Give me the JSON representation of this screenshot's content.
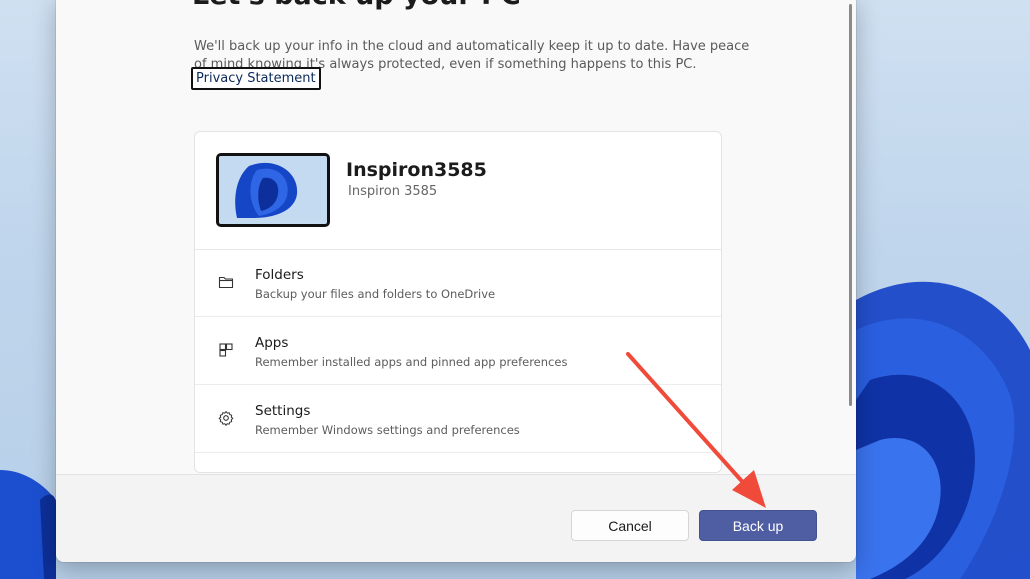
{
  "dialog": {
    "title": "Let's back up your PC",
    "intro": "We'll back up your info in the cloud and automatically keep it up to date. Have peace of mind knowing it's always protected, even if something happens to this PC.",
    "privacy_link": "Privacy Statement"
  },
  "device": {
    "name": "Inspiron3585",
    "model": "Inspiron 3585"
  },
  "options": [
    {
      "icon": "folder-icon",
      "title": "Folders",
      "subtitle": "Backup your files and folders to OneDrive"
    },
    {
      "icon": "apps-icon",
      "title": "Apps",
      "subtitle": "Remember installed apps and pinned app preferences"
    },
    {
      "icon": "gear-icon",
      "title": "Settings",
      "subtitle": "Remember Windows settings and preferences"
    }
  ],
  "footer": {
    "cancel_label": "Cancel",
    "backup_label": "Back up"
  },
  "colors": {
    "accent": "#4f5ea3",
    "annotation_arrow": "#f04a3a",
    "wallpaper_blue": "#1746c8"
  }
}
